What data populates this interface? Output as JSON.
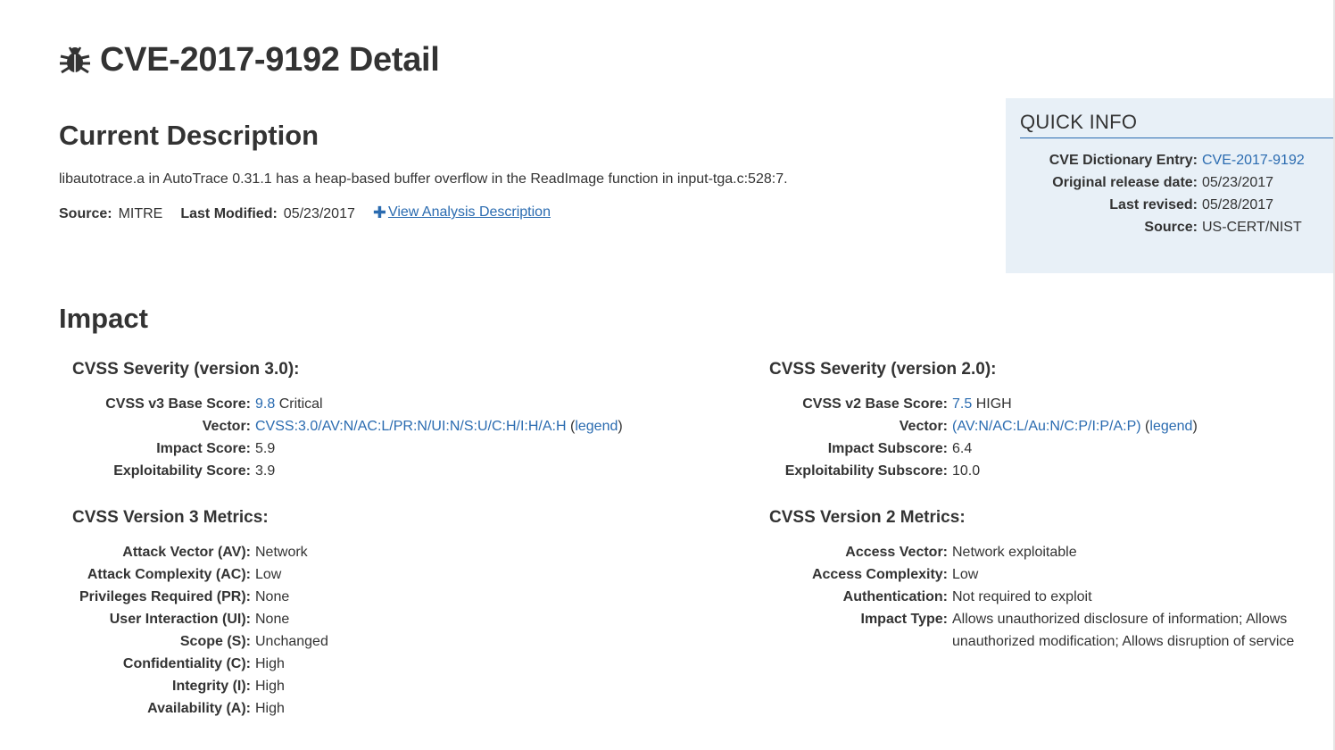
{
  "title": "CVE-2017-9192 Detail",
  "description": {
    "heading": "Current Description",
    "text": "libautotrace.a in AutoTrace 0.31.1 has a heap-based buffer overflow in the ReadImage function in input-tga.c:528:7.",
    "source_label": "Source:",
    "source_value": "MITRE",
    "modified_label": "Last Modified:",
    "modified_value": "05/23/2017",
    "analysis_link": "View Analysis Description"
  },
  "quick_info": {
    "title": "QUICK INFO",
    "rows": [
      {
        "label": "CVE Dictionary Entry:",
        "value": "CVE-2017-9192"
      },
      {
        "label": "Original release date:",
        "value": "05/23/2017"
      },
      {
        "label": "Last revised:",
        "value": "05/28/2017"
      },
      {
        "label": "Source:",
        "value": "US-CERT/NIST"
      }
    ]
  },
  "impact": {
    "heading": "Impact",
    "v3": {
      "severity_heading": "CVSS Severity (version 3.0):",
      "base_score_label": "CVSS v3 Base Score:",
      "base_score": "9.8",
      "severity": "Critical",
      "vector_label": "Vector:",
      "vector": "CVSS:3.0/AV:N/AC:L/PR:N/UI:N/S:U/C:H/I:H/A:H",
      "legend": "legend",
      "impact_label": "Impact Score:",
      "impact_value": "5.9",
      "exploit_label": "Exploitability Score:",
      "exploit_value": "3.9",
      "metrics_heading": "CVSS Version 3 Metrics:",
      "metrics": [
        {
          "label": "Attack Vector (AV):",
          "value": "Network"
        },
        {
          "label": "Attack Complexity (AC):",
          "value": "Low"
        },
        {
          "label": "Privileges Required (PR):",
          "value": "None"
        },
        {
          "label": "User Interaction (UI):",
          "value": "None"
        },
        {
          "label": "Scope (S):",
          "value": "Unchanged"
        },
        {
          "label": "Confidentiality (C):",
          "value": "High"
        },
        {
          "label": "Integrity (I):",
          "value": "High"
        },
        {
          "label": "Availability (A):",
          "value": "High"
        }
      ]
    },
    "v2": {
      "severity_heading": "CVSS Severity (version 2.0):",
      "base_score_label": "CVSS v2 Base Score:",
      "base_score": "7.5",
      "severity": "HIGH",
      "vector_label": "Vector:",
      "vector": "(AV:N/AC:L/Au:N/C:P/I:P/A:P)",
      "legend": "legend",
      "impact_label": "Impact Subscore:",
      "impact_value": "6.4",
      "exploit_label": "Exploitability Subscore:",
      "exploit_value": "10.0",
      "metrics_heading": "CVSS Version 2 Metrics:",
      "metrics": [
        {
          "label": "Access Vector:",
          "value": "Network exploitable"
        },
        {
          "label": "Access Complexity:",
          "value": "Low"
        },
        {
          "label": "Authentication:",
          "value": "Not required to exploit"
        },
        {
          "label": "Impact Type:",
          "value": "Allows unauthorized disclosure of information; Allows unauthorized modification; Allows disruption of service"
        }
      ]
    }
  }
}
